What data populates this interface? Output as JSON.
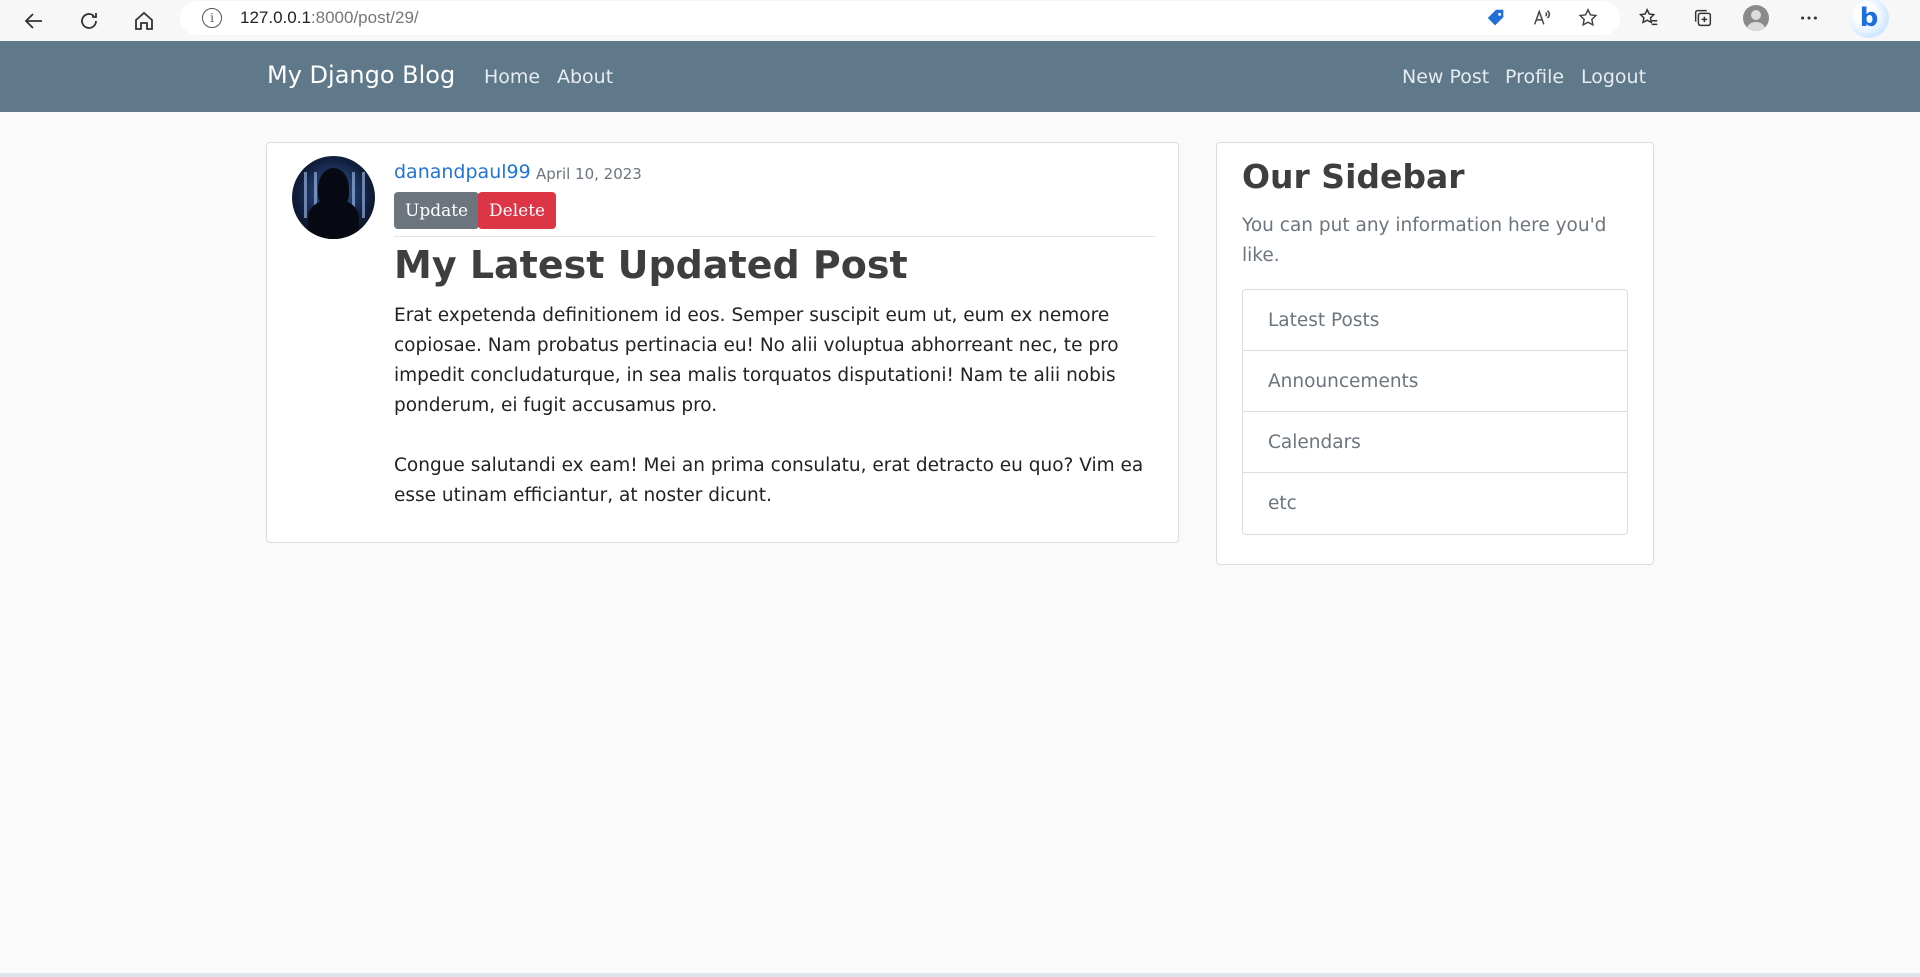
{
  "browser": {
    "url_host": "127.0.0.1",
    "url_rest": ":8000/post/29/"
  },
  "navbar": {
    "brand": "My Django Blog",
    "left_links": [
      "Home",
      "About"
    ],
    "right_links": [
      "New Post",
      "Profile",
      "Logout"
    ]
  },
  "post": {
    "author": "danandpaul99",
    "date": "April 10, 2023",
    "update_label": "Update",
    "delete_label": "Delete",
    "title": "My Latest Updated Post",
    "paragraphs": [
      "Erat expetenda definitionem id eos. Semper suscipit eum ut, eum ex nemore copiosae. Nam probatus pertinacia eu! No alii voluptua abhorreant nec, te pro impedit concludaturque, in sea malis torquatos disputationi! Nam te alii nobis ponderum, ei fugit accusamus pro.",
      "Congue salutandi ex eam! Mei an prima consulatu, erat detracto eu quo? Vim ea esse utinam efficiantur, at noster dicunt."
    ]
  },
  "sidebar": {
    "title": "Our Sidebar",
    "text": "You can put any information here you'd like.",
    "items": [
      "Latest Posts",
      "Announcements",
      "Calendars",
      "etc"
    ]
  },
  "colors": {
    "navbar": "#5f788a",
    "link": "#2275d7",
    "update_button": "#6c757d",
    "delete_button": "#dc3545"
  }
}
